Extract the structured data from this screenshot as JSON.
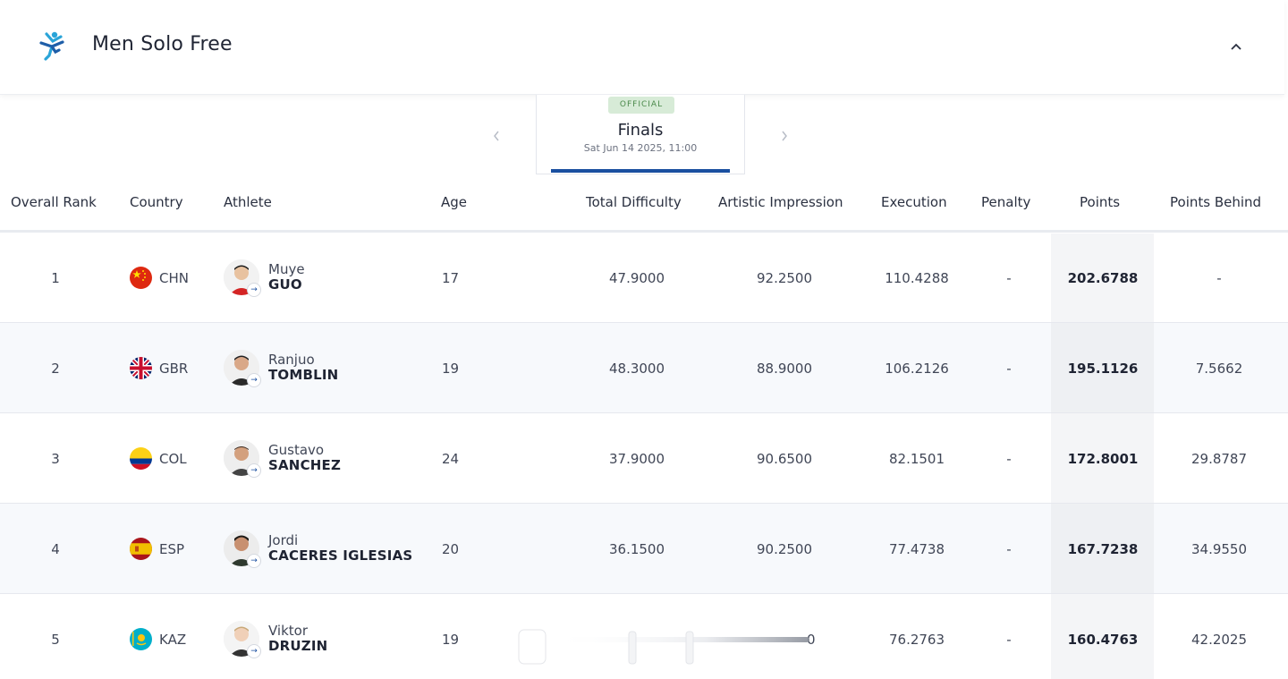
{
  "header": {
    "title": "Men Solo Free",
    "icon": "artistic-swimming-icon",
    "collapse_icon": "chevron-up-icon"
  },
  "phase": {
    "badge": "OFFICIAL",
    "title": "Finals",
    "date": "Sat Jun 14 2025, 11:00",
    "prev_icon": "chevron-left-icon",
    "next_icon": "chevron-right-icon"
  },
  "table": {
    "columns": {
      "rank": "Overall Rank",
      "country": "Country",
      "athlete": "Athlete",
      "age": "Age",
      "difficulty": "Total Difficulty",
      "artistic": "Artistic Impression",
      "execution": "Execution",
      "penalty": "Penalty",
      "points": "Points",
      "behind": "Points Behind"
    },
    "rows": [
      {
        "rank": "1",
        "country": "CHN",
        "given": "Muye",
        "family": "GUO",
        "age": "17",
        "difficulty": "47.9000",
        "artistic": "92.2500",
        "execution": "110.4288",
        "penalty": "-",
        "points": "202.6788",
        "behind": "-"
      },
      {
        "rank": "2",
        "country": "GBR",
        "given": "Ranjuo",
        "family": "TOMBLIN",
        "age": "19",
        "difficulty": "48.3000",
        "artistic": "88.9000",
        "execution": "106.2126",
        "penalty": "-",
        "points": "195.1126",
        "behind": "7.5662"
      },
      {
        "rank": "3",
        "country": "COL",
        "given": "Gustavo",
        "family": "SANCHEZ",
        "age": "24",
        "difficulty": "37.9000",
        "artistic": "90.6500",
        "execution": "82.1501",
        "penalty": "-",
        "points": "172.8001",
        "behind": "29.8787"
      },
      {
        "rank": "4",
        "country": "ESP",
        "given": "Jordi",
        "family": "CACERES IGLESIAS",
        "age": "20",
        "difficulty": "36.1500",
        "artistic": "90.2500",
        "execution": "77.4738",
        "penalty": "-",
        "points": "167.7238",
        "behind": "34.9550"
      },
      {
        "rank": "5",
        "country": "KAZ",
        "given": "Viktor",
        "family": "DRUZIN",
        "age": "19",
        "difficulty": "",
        "artistic": "0",
        "execution": "76.2763",
        "penalty": "-",
        "points": "160.4763",
        "behind": "42.2025"
      }
    ]
  },
  "colors": {
    "accent": "#1a4fa0",
    "official_bg": "#d7ebd7",
    "official_text": "#4b8a4b",
    "icon_blue": "#2aa4d8",
    "icon_navy": "#1e5ea8"
  }
}
